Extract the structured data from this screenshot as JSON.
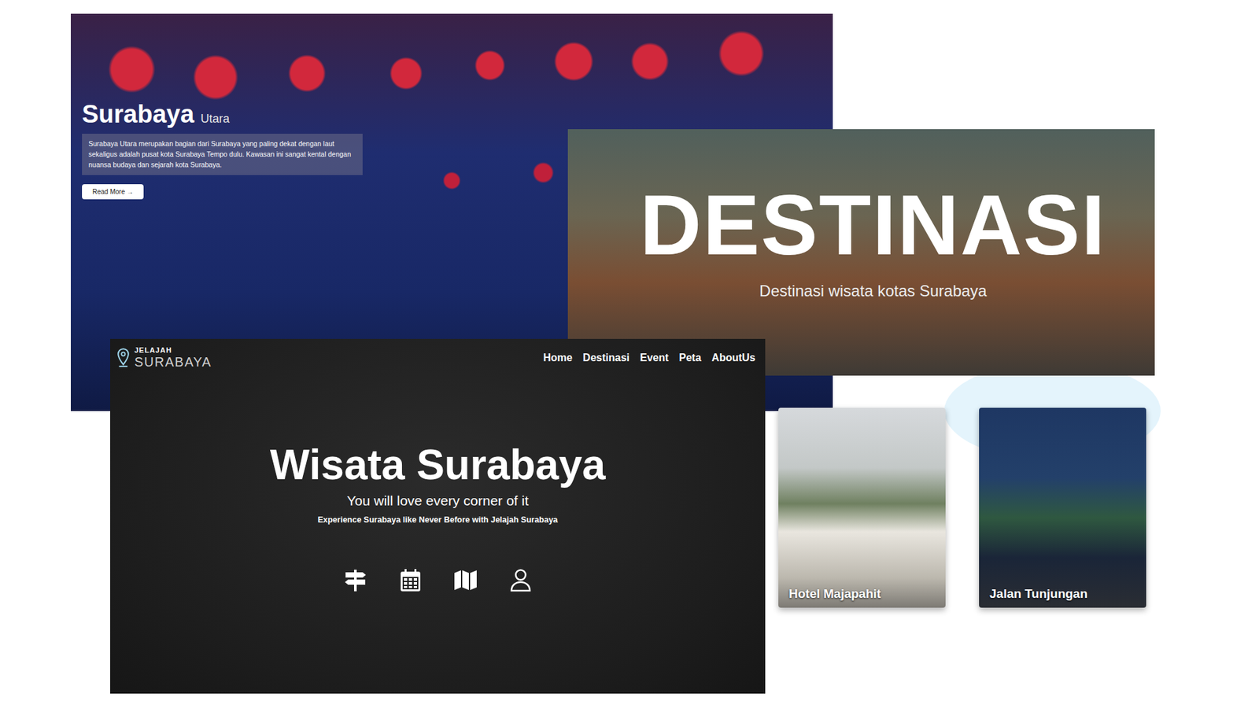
{
  "north_panel": {
    "title": "Surabaya",
    "subtitle": "Utara",
    "description": "Surabaya Utara merupakan bagian dari Surabaya yang paling dekat dengan laut sekaligus adalah pusat kota Surabaya Tempo dulu. Kawasan ini sangat kental dengan nuansa budaya dan sejarah kota Surabaya.",
    "button": "Read More →"
  },
  "destination_panel": {
    "title": "DESTINASI",
    "subtitle": "Destinasi wisata kotas Surabaya"
  },
  "home_panel": {
    "logo": {
      "top": "JELAJAH",
      "bottom": "SURABAYA"
    },
    "nav": [
      {
        "label": "Home"
      },
      {
        "label": "Destinasi"
      },
      {
        "label": "Event"
      },
      {
        "label": "Peta"
      },
      {
        "label": "AboutUs"
      }
    ],
    "title": "Wisata Surabaya",
    "tagline": "You will love every corner of it",
    "subtitle": "Experience Surabaya like Never Before with Jelajah Surabaya"
  },
  "cards": [
    {
      "label": "Hotel Majapahit"
    },
    {
      "label": "Jalan Tunjungan"
    }
  ]
}
